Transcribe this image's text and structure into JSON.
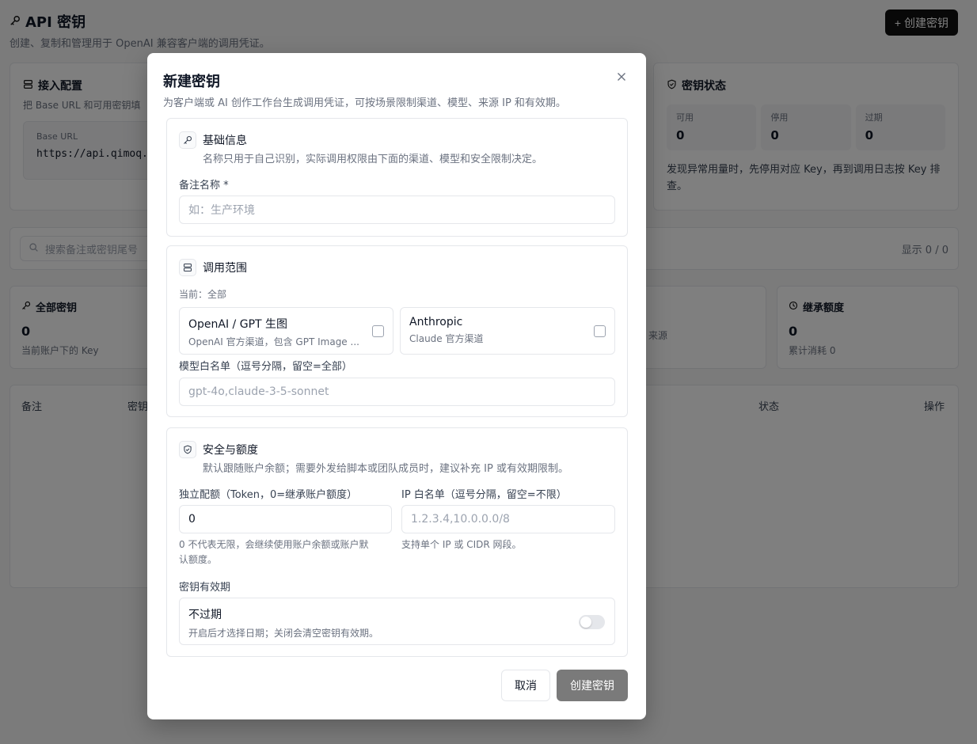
{
  "page": {
    "title": "API 密钥",
    "subtitle": "创建、复制和管理用于 OpenAI 兼容客户端的调用凭证。",
    "create_button": "+ 创建密钥"
  },
  "connection": {
    "title": "接入配置",
    "desc": "把 Base URL 和可用密钥填",
    "base_url_label": "Base URL",
    "base_url_value": "https://api.qimoq.c"
  },
  "key_status": {
    "title": "密钥状态",
    "cells": [
      {
        "label": "可用",
        "value": "0"
      },
      {
        "label": "停用",
        "value": "0"
      },
      {
        "label": "过期",
        "value": "0"
      }
    ],
    "note": "发现异常用量时，先停用对应 Key，再到调用日志按 Key 排查。"
  },
  "search": {
    "placeholder": "搜索备注或密钥尾号",
    "count": "显示 0 / 0"
  },
  "stats": {
    "all_keys": {
      "title": "全部密钥",
      "value": "0",
      "sub": "当前账户下的 Key"
    },
    "third_sub": "来源",
    "inherit_quota": {
      "title": "继承额度",
      "value": "0",
      "sub": "累计消耗 0"
    }
  },
  "table": {
    "headers": [
      "备注",
      "密钥",
      "状态",
      "操作"
    ]
  },
  "dialog": {
    "title": "新建密钥",
    "desc": "为客户端或 AI 创作工作台生成调用凭证，可按场景限制渠道、模型、来源 IP 和有效期。",
    "basic": {
      "title": "基础信息",
      "desc": "名称只用于自己识别，实际调用权限由下面的渠道、模型和安全限制决定。",
      "name_label": "备注名称 *",
      "name_placeholder": "如：生产环境"
    },
    "scope": {
      "title": "调用范围",
      "current": "当前：全部",
      "channels": [
        {
          "title": "OpenAI / GPT 生图",
          "desc": "OpenAI 官方渠道，包含 GPT Image ...",
          "checked": false
        },
        {
          "title": "Anthropic",
          "desc": "Claude 官方渠道",
          "checked": false
        }
      ],
      "models_label": "模型白名单（逗号分隔，留空=全部）",
      "models_placeholder": "gpt-4o,claude-3-5-sonnet"
    },
    "security": {
      "title": "安全与额度",
      "desc": "默认跟随账户余额；需要外发给脚本或团队成员时，建议补充 IP 或有效期限制。",
      "quota_label": "独立配额（Token，0=继承账户额度）",
      "quota_value": "0",
      "quota_hint_1": "0 不代表无限，会继续使用账户余额或账户默",
      "quota_hint_2": "认额度。",
      "ip_label": "IP 白名单（逗号分隔，留空=不限）",
      "ip_placeholder": "1.2.3.4,10.0.0.0/8",
      "ip_hint": "支持单个 IP 或 CIDR 网段。",
      "expiry_label": "密钥有效期",
      "expiry_title": "不过期",
      "expiry_desc": "开启后才选择日期；关闭会清空密钥有效期。",
      "expiry_enabled": false
    },
    "cancel": "取消",
    "submit": "创建密钥"
  }
}
